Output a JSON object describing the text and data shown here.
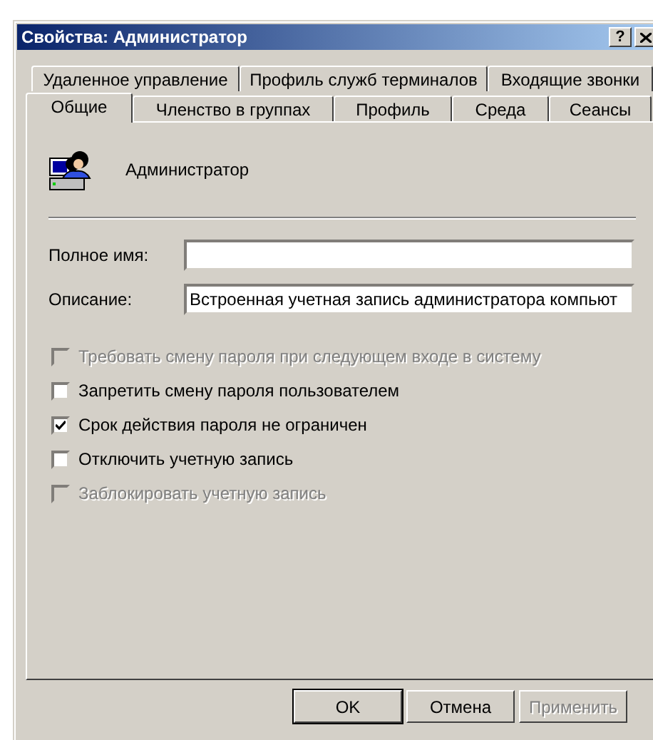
{
  "window": {
    "title": "Свойства: Администратор",
    "help": "?"
  },
  "tab_rows": [
    [
      {
        "label": "Удаленное управление",
        "selected": false
      },
      {
        "label": "Профиль служб терминалов",
        "selected": false
      },
      {
        "label": "Входящие звонки",
        "selected": false
      }
    ],
    [
      {
        "label": "Общие",
        "selected": true
      },
      {
        "label": "Членство в группах",
        "selected": false
      },
      {
        "label": "Профиль",
        "selected": false
      },
      {
        "label": "Среда",
        "selected": false
      },
      {
        "label": "Сеансы",
        "selected": false
      }
    ]
  ],
  "user": {
    "name": "Администратор"
  },
  "fields": [
    {
      "label": "Полное имя:"
    },
    {
      "label": "Описание:",
      "value": "Встроенная учетная запись администратора компьют"
    }
  ],
  "options": [
    {
      "label": "Требовать смену пароля при следующем входе в систему",
      "checked": false,
      "disabled": true
    },
    {
      "label": "Запретить смену пароля пользователем",
      "checked": false,
      "disabled": false
    },
    {
      "label": "Срок действия пароля не ограничен",
      "checked": true,
      "disabled": false
    },
    {
      "label": "Отключить учетную запись",
      "checked": false,
      "disabled": false
    },
    {
      "label": "Заблокировать учетную запись",
      "checked": false,
      "disabled": true
    }
  ],
  "buttons": [
    {
      "label": "OK",
      "disabled": false,
      "default": true
    },
    {
      "label": "Отмена",
      "disabled": false,
      "default": false
    },
    {
      "label": "Применить",
      "disabled": true,
      "default": false
    }
  ]
}
